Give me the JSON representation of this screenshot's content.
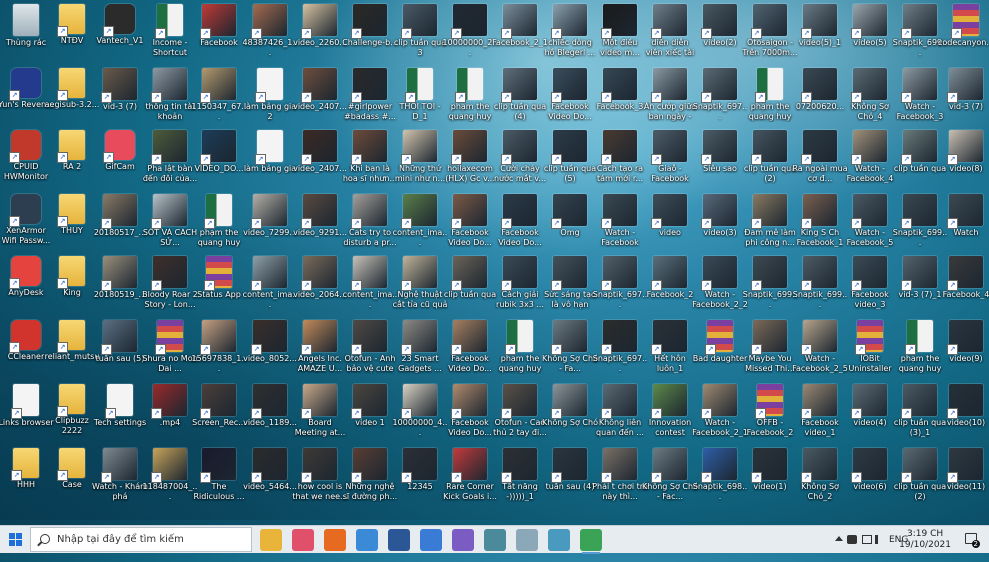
{
  "desktop": {
    "columns": [
      [
        {
          "label": "Thùng rác",
          "kind": "recycle"
        },
        {
          "label": "Yun's Reven...",
          "kind": "app",
          "color": "#243a8c"
        },
        {
          "label": "CPUID HWMonitor",
          "kind": "app",
          "color": "#c0392b"
        },
        {
          "label": "XenArmor Wifi Passw...",
          "kind": "app",
          "color": "#2c3e50"
        },
        {
          "label": "AnyDesk",
          "kind": "app",
          "color": "#e5433d"
        },
        {
          "label": "CCleaner",
          "kind": "app",
          "color": "#d0342c"
        },
        {
          "label": "Links browser",
          "kind": "doc"
        },
        {
          "label": "HHH",
          "kind": "folder"
        }
      ],
      [
        {
          "label": "NTĐV",
          "kind": "folder"
        },
        {
          "label": "aegisub-3.2...",
          "kind": "folder"
        },
        {
          "label": "RA 2",
          "kind": "folder"
        },
        {
          "label": "THÚY",
          "kind": "folder"
        },
        {
          "label": "King",
          "kind": "folder"
        },
        {
          "label": "reliant_mutsu",
          "kind": "folder"
        },
        {
          "label": "Clipbuzz 2222",
          "kind": "folder"
        },
        {
          "label": "Case",
          "kind": "folder"
        }
      ],
      [
        {
          "label": "Vantech_V1",
          "kind": "app",
          "color": "#2b2b2b"
        },
        {
          "label": "vid-3 (7)",
          "kind": "video",
          "color": "#6b5a4a"
        },
        {
          "label": "GifCam",
          "kind": "app",
          "color": "#e84b5c"
        },
        {
          "label": "20180517_...",
          "kind": "video",
          "color": "#8a7a66"
        },
        {
          "label": "20180519_...",
          "kind": "video",
          "color": "#9a8f7c"
        },
        {
          "label": "tuần sau (5)",
          "kind": "video",
          "color": "#5b6f83"
        },
        {
          "label": "Tech settings",
          "kind": "doc"
        },
        {
          "label": "Watch - Khám phá",
          "kind": "video",
          "color": "#7f8a92"
        }
      ],
      [
        {
          "label": "Income - Shortcut",
          "kind": "excel"
        },
        {
          "label": "thông tin tài khoản",
          "kind": "video",
          "color": "#8e9aa3"
        },
        {
          "label": "Pha lật bàn đến đôi của...",
          "kind": "video",
          "color": "#4e5c3a"
        },
        {
          "label": "SỐT VÀ CÁCH SỬ...",
          "kind": "video",
          "color": "#b8c2c8"
        },
        {
          "label": "Bloody Roar 2 Story - Lon...",
          "kind": "video",
          "color": "#3f2f2a"
        },
        {
          "label": "Shura no Mon Dai ...",
          "kind": "rar"
        },
        {
          "label": ".mp4",
          "kind": "video",
          "color": "#9a2a2a"
        },
        {
          "label": "118487004_...",
          "kind": "video",
          "color": "#c8a45a"
        }
      ],
      [
        {
          "label": "Facebook",
          "kind": "video",
          "color": "#c03a36"
        },
        {
          "label": "1150347_67...",
          "kind": "video",
          "color": "#b59a6e"
        },
        {
          "label": "VIDEO_DO...",
          "kind": "video",
          "color": "#1c3d58"
        },
        {
          "label": "phạm the quang huy",
          "kind": "excel"
        },
        {
          "label": "Status App",
          "kind": "rar"
        },
        {
          "label": "15697838_1...",
          "kind": "video",
          "color": "#c5a082"
        },
        {
          "label": "Screen_Rec...",
          "kind": "video",
          "color": "#4b3f3a"
        },
        {
          "label": "The Ridiculous ...",
          "kind": "video",
          "color": "#1a1a2e"
        }
      ],
      [
        {
          "label": "48387426_1...",
          "kind": "video",
          "color": "#a56b4f"
        },
        {
          "label": "làm bảng gia 2",
          "kind": "doc"
        },
        {
          "label": "làm bảng gia",
          "kind": "doc"
        },
        {
          "label": "video_7299...",
          "kind": "video",
          "color": "#b5b0a6"
        },
        {
          "label": "content_ima...",
          "kind": "video",
          "color": "#8fa0a8"
        },
        {
          "label": "video_8052...",
          "kind": "video",
          "color": "#3a2e2a"
        },
        {
          "label": "video_1189...",
          "kind": "video",
          "color": "#2f2f2f"
        },
        {
          "label": "video_5464...",
          "kind": "video",
          "color": "#2b2b2b"
        }
      ],
      [
        {
          "label": "video_2260...",
          "kind": "video",
          "color": "#d6c2a1"
        },
        {
          "label": "video_2407...",
          "kind": "video",
          "color": "#6e4e3c"
        },
        {
          "label": "video_2407...",
          "kind": "video",
          "color": "#3c2a23"
        },
        {
          "label": "video_9291...",
          "kind": "video",
          "color": "#5a4a40"
        },
        {
          "label": "video_2064...",
          "kind": "video",
          "color": "#7a6b5a"
        },
        {
          "label": "Angels Inc. AMAZE U...",
          "kind": "video",
          "color": "#c28a5a"
        },
        {
          "label": "Board Meeting at...",
          "kind": "video",
          "color": "#c9a98a"
        },
        {
          "label": "how cool is that we nee...",
          "kind": "video",
          "color": "#3e3a36"
        }
      ],
      [
        {
          "label": "Challenge-b...",
          "kind": "video",
          "color": "#2c2824"
        },
        {
          "label": "#girlpower #badass #...",
          "kind": "video",
          "color": "#2a2a2a"
        },
        {
          "label": "Khi bạn là hoa sĩ nhưn...",
          "kind": "video",
          "color": "#6e4b3a"
        },
        {
          "label": "Cats try to disturb a pr...",
          "kind": "video",
          "color": "#a5a09a"
        },
        {
          "label": "content_ima...",
          "kind": "video",
          "color": "#c7c2b9"
        },
        {
          "label": "Otofun - Anh bảo vệ cute ...",
          "kind": "video",
          "color": "#4f4a44"
        },
        {
          "label": "video 1",
          "kind": "video",
          "color": "#4c463f"
        },
        {
          "label": "Những nghệ sĩ đường ph...",
          "kind": "video",
          "color": "#5a3e33"
        }
      ],
      [
        {
          "label": "clip tuần qua 3",
          "kind": "video",
          "color": "#4a5a66"
        },
        {
          "label": "THÓI TOI -D_1",
          "kind": "excel"
        },
        {
          "label": "Những thứ mini như n...",
          "kind": "video",
          "color": "#d2c4ae"
        },
        {
          "label": "content_ima...",
          "kind": "video",
          "color": "#5b7f4a"
        },
        {
          "label": "Nghệ thuật cắt tỉa cũ quả",
          "kind": "video",
          "color": "#c1b49a"
        },
        {
          "label": "23 Smart Gadgets ...",
          "kind": "video",
          "color": "#8d8a84"
        },
        {
          "label": "10000000_4...",
          "kind": "video",
          "color": "#d9d2c4"
        },
        {
          "label": "12345",
          "kind": "video",
          "color": "#2c2f36"
        }
      ],
      [
        {
          "label": "10000000_2...",
          "kind": "video",
          "color": "#222831"
        },
        {
          "label": "phạm the quang huy (2)",
          "kind": "excel"
        },
        {
          "label": "hoilaxecom (HLX) Gc v...",
          "kind": "video",
          "color": "#6a4c3a"
        },
        {
          "label": "Facebook Video Do...",
          "kind": "video",
          "color": "#7c5a47"
        },
        {
          "label": "clip tuần qua",
          "kind": "video",
          "color": "#6b6358"
        },
        {
          "label": "Facebook Video Do...",
          "kind": "video",
          "color": "#a77f60"
        },
        {
          "label": "Facebook Video Do...",
          "kind": "video",
          "color": "#b08a6c"
        },
        {
          "label": "Rare Corner Kick Goals i...",
          "kind": "video",
          "color": "#c33b3b"
        }
      ],
      [
        {
          "label": "Facebook_2_1",
          "kind": "video",
          "color": "#7b8f9c"
        },
        {
          "label": "clip tuần qua (4)",
          "kind": "video",
          "color": "#5f6f7a"
        },
        {
          "label": "Cười chảy nước mắt v...",
          "kind": "video",
          "color": "#4c5b66"
        },
        {
          "label": "Facebook Video Do...",
          "kind": "video",
          "color": "#2b3a48"
        },
        {
          "label": "Cách giải rubik 3x3 ...",
          "kind": "video",
          "color": "#3a4a55"
        },
        {
          "label": "phạm the quang huy (3)",
          "kind": "excel"
        },
        {
          "label": "Otofun - Cao thủ 2 tay đi...",
          "kind": "video",
          "color": "#5a5148"
        },
        {
          "label": "Tất năng -)))))_1",
          "kind": "video",
          "color": "#2d3035"
        }
      ],
      [
        {
          "label": "chiếc dòng hồ Blegerl ...",
          "kind": "video",
          "color": "#8ba0ad"
        },
        {
          "label": "Facebook Video Do...",
          "kind": "video",
          "color": "#3a4d5c"
        },
        {
          "label": "clip tuần qua (5)",
          "kind": "video",
          "color": "#2c3c48"
        },
        {
          "label": "Omg",
          "kind": "video",
          "color": "#344450"
        },
        {
          "label": "Sức sáng tạo là vô hạn",
          "kind": "video",
          "color": "#44525c"
        },
        {
          "label": "Không Sợ Chó - Fa...",
          "kind": "video",
          "color": "#6d7a82"
        },
        {
          "label": "Không Sợ Chó",
          "kind": "video",
          "color": "#8b9599"
        },
        {
          "label": "tuần sau (4)",
          "kind": "video",
          "color": "#2a3540"
        }
      ],
      [
        {
          "label": "Một điều video m...",
          "kind": "video",
          "color": "#1b1b1b"
        },
        {
          "label": "Facebook_3",
          "kind": "video",
          "color": "#364855"
        },
        {
          "label": "Cách tạo ra tám mới r...",
          "kind": "video",
          "color": "#4a3a30"
        },
        {
          "label": "Watch - Facebook",
          "kind": "video",
          "color": "#3a4a54"
        },
        {
          "label": "Snaptik_697...",
          "kind": "video",
          "color": "#52606a"
        },
        {
          "label": "Snaptik_697...",
          "kind": "video",
          "color": "#2c2c2c"
        },
        {
          "label": "Không liên quan đến ...",
          "kind": "video",
          "color": "#5b6a74"
        },
        {
          "label": "Phải t chơi trò này thì...",
          "kind": "video",
          "color": "#7b7067"
        }
      ],
      [
        {
          "label": "diễn diễn viên xiếc tài ba c...",
          "kind": "video",
          "color": "#6f7f8a"
        },
        {
          "label": "Ăn cướp giữa ban ngày -",
          "kind": "video",
          "color": "#8a9aa4"
        },
        {
          "label": "Giaỗ - Facebook",
          "kind": "video",
          "color": "#4d5d68"
        },
        {
          "label": "video",
          "kind": "video",
          "color": "#3e4e59"
        },
        {
          "label": "Facebook_2",
          "kind": "video",
          "color": "#5a6f7b"
        },
        {
          "label": "Hết hôn luôn_1",
          "kind": "video",
          "color": "#2a3138"
        },
        {
          "label": "Innovation contest",
          "kind": "video",
          "color": "#5c8a4a"
        },
        {
          "label": "Không Sợ Chó - Fac...",
          "kind": "video",
          "color": "#6d7b83"
        }
      ],
      [
        {
          "label": "video(2)",
          "kind": "video",
          "color": "#4a5963"
        },
        {
          "label": "Snaptik_697...",
          "kind": "video",
          "color": "#5a6b75"
        },
        {
          "label": "Siêu sao",
          "kind": "video",
          "color": "#4c5c66"
        },
        {
          "label": "video(3)",
          "kind": "video",
          "color": "#59697a"
        },
        {
          "label": "Watch - Facebook_2_2",
          "kind": "video",
          "color": "#3a4a56"
        },
        {
          "label": "Bad daughter",
          "kind": "rar"
        },
        {
          "label": "Watch - Facebook_2_1",
          "kind": "video",
          "color": "#a08a72"
        },
        {
          "label": "Snaptik_698...",
          "kind": "video",
          "color": "#2e5fa8"
        }
      ],
      [
        {
          "label": "Otosaigon - Trên 7000m...",
          "kind": "video",
          "color": "#516471"
        },
        {
          "label": "phạm the quang huy (4)",
          "kind": "excel"
        },
        {
          "label": "clip tuần qua (2)",
          "kind": "video",
          "color": "#455560"
        },
        {
          "label": "Đam mê làm phi công n...",
          "kind": "video",
          "color": "#8a7a62"
        },
        {
          "label": "Snaptik_699...",
          "kind": "video",
          "color": "#3e4a52"
        },
        {
          "label": "Maybe You Missed Thi...",
          "kind": "video",
          "color": "#7c6a58"
        },
        {
          "label": "OFFB - Facebook_2",
          "kind": "rar"
        },
        {
          "label": "video(1)",
          "kind": "video",
          "color": "#2b333a"
        }
      ],
      [
        {
          "label": "video(5)_1",
          "kind": "video",
          "color": "#6a7a84"
        },
        {
          "label": "07200620...",
          "kind": "video",
          "color": "#3a4954"
        },
        {
          "label": "Ra ngoài mua cơ đ...",
          "kind": "video",
          "color": "#2c3a44"
        },
        {
          "label": "King S Ch Facebook_1",
          "kind": "video",
          "color": "#7a6050"
        },
        {
          "label": "Snaptik_699...",
          "kind": "video",
          "color": "#4d5b64"
        },
        {
          "label": "Watch - Facebook_2_5",
          "kind": "video",
          "color": "#b7a48c"
        },
        {
          "label": "Facebook video_1",
          "kind": "video",
          "color": "#9a8874"
        },
        {
          "label": "Không Sợ Chó_2",
          "kind": "video",
          "color": "#4a5a63"
        }
      ],
      [
        {
          "label": "video(5)",
          "kind": "video",
          "color": "#9aa6ad"
        },
        {
          "label": "Không Sợ Chó_4",
          "kind": "video",
          "color": "#5b6b75"
        },
        {
          "label": "Watch - Facebook_4",
          "kind": "video",
          "color": "#a2917a"
        },
        {
          "label": "Watch - Facebook_5",
          "kind": "video",
          "color": "#4a5963"
        },
        {
          "label": "Facebook video_3",
          "kind": "video",
          "color": "#3b4b56"
        },
        {
          "label": "IOBit Uninstaller",
          "kind": "rar"
        },
        {
          "label": "video(4)",
          "kind": "video",
          "color": "#5c6a73"
        },
        {
          "label": "video(6)",
          "kind": "video",
          "color": "#2e3a44"
        }
      ],
      [
        {
          "label": "Snaptik_699...",
          "kind": "video",
          "color": "#6f7e88"
        },
        {
          "label": "Watch - Facebook_3",
          "kind": "video",
          "color": "#8d9aa2"
        },
        {
          "label": "clip tuần qua",
          "kind": "video",
          "color": "#6a7a7a"
        },
        {
          "label": "Snaptik_699...",
          "kind": "video",
          "color": "#3a4852"
        },
        {
          "label": "vid-3 (7)_1",
          "kind": "video",
          "color": "#54636d"
        },
        {
          "label": "phạm the quang huy (5)",
          "kind": "excel"
        },
        {
          "label": "clip tuần qua (3)_1",
          "kind": "video",
          "color": "#4b5a63"
        },
        {
          "label": "clip tuần qua (2)",
          "kind": "video",
          "color": "#5a6973"
        }
      ],
      [
        {
          "label": "codecanyon...",
          "kind": "rar"
        },
        {
          "label": "vid-3 (7)",
          "kind": "video",
          "color": "#7f8e98"
        },
        {
          "label": "video(8)",
          "kind": "video",
          "color": "#c9c0b2"
        },
        {
          "label": "Watch",
          "kind": "video",
          "color": "#3c4a54"
        },
        {
          "label": "Facebook_4",
          "kind": "video",
          "color": "#3a3a3a"
        },
        {
          "label": "video(9)",
          "kind": "video",
          "color": "#2a3540"
        },
        {
          "label": "video(10)",
          "kind": "video",
          "color": "#263039"
        },
        {
          "label": "video(11)",
          "kind": "video",
          "color": "#2f3942"
        }
      ]
    ]
  },
  "taskbar": {
    "search_placeholder": "Nhập tại đây để tìm kiếm",
    "apps": [
      {
        "name": "file-explorer-icon",
        "color": "#e8b43a"
      },
      {
        "name": "camera-app-icon",
        "color": "#e0506a"
      },
      {
        "name": "firefox-icon",
        "color": "#e66a1f"
      },
      {
        "name": "chrome-icon",
        "color": "#3b8ad8"
      },
      {
        "name": "word-icon",
        "color": "#2b5797"
      },
      {
        "name": "store-icon",
        "color": "#3a7bd5"
      },
      {
        "name": "photos-icon",
        "color": "#7a5cc2"
      },
      {
        "name": "network-tool-icon",
        "color": "#4a8a9a"
      },
      {
        "name": "pen-tool-icon",
        "color": "#8aa8b8"
      },
      {
        "name": "remote-app-icon",
        "color": "#4a9abf"
      },
      {
        "name": "green-app-icon",
        "color": "#3aa356"
      }
    ],
    "language": "ENG",
    "time": "3:19 CH",
    "date": "19/10/2021",
    "notification_count": "2"
  }
}
